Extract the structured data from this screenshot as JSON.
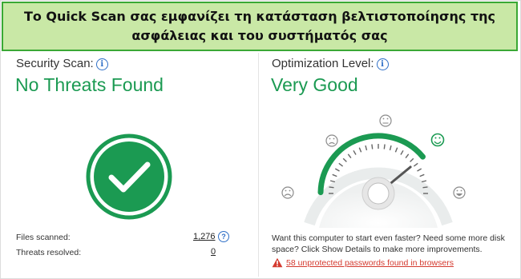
{
  "banner": {
    "text": "Το Quick Scan σας εμφανίζει τη κατάσταση βελτιστοποίησης της ασφάλειας και του συστήματός σας"
  },
  "security": {
    "label": "Security Scan:",
    "status": "No Threats Found",
    "info_icon": "info-icon",
    "stats": [
      {
        "label": "Files scanned:",
        "value": "1,276"
      },
      {
        "label": "Threats resolved:",
        "value": "0"
      }
    ]
  },
  "optimization": {
    "label": "Optimization Level:",
    "status": "Very Good",
    "gauge_level": 0.78,
    "message": "Want this computer to start even faster? Need some more disk space? Click Show Details to make more improvements.",
    "alert": "58 unprotected passwords found in browsers"
  },
  "colors": {
    "accent_green": "#1b9a52",
    "banner_bg": "#c9e8a6",
    "banner_border": "#3aa835",
    "info_blue": "#2e6fc7",
    "alert_red": "#d43a2f"
  }
}
